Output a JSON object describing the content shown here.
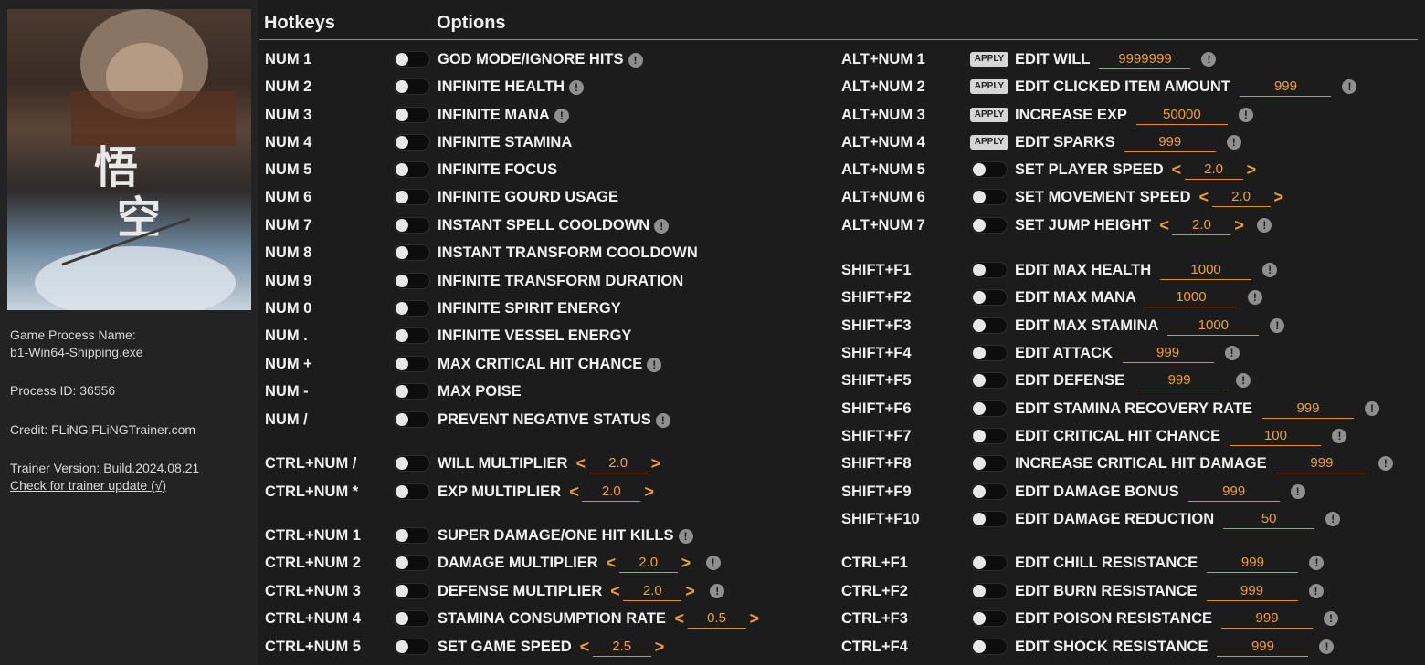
{
  "headers": {
    "hotkeys": "Hotkeys",
    "options": "Options"
  },
  "sidebar": {
    "process_name_label": "Game Process Name:",
    "process_name": "b1-Win64-Shipping.exe",
    "process_id": "Process ID: 36556",
    "credit": "Credit: FLiNG|FLiNGTrainer.com",
    "version": "Trainer Version: Build.2024.08.21",
    "update_link": "Check for trainer update (√)"
  },
  "apply_label": "APPLY",
  "left_options": [
    {
      "key": "NUM 1",
      "label": "GOD MODE/IGNORE HITS",
      "info": true
    },
    {
      "key": "NUM 2",
      "label": "INFINITE HEALTH",
      "info": true
    },
    {
      "key": "NUM 3",
      "label": "INFINITE MANA",
      "info": true
    },
    {
      "key": "NUM 4",
      "label": "INFINITE STAMINA",
      "info": false
    },
    {
      "key": "NUM 5",
      "label": "INFINITE FOCUS",
      "info": false
    },
    {
      "key": "NUM 6",
      "label": "INFINITE GOURD USAGE",
      "info": false
    },
    {
      "key": "NUM 7",
      "label": "INSTANT SPELL COOLDOWN",
      "info": true
    },
    {
      "key": "NUM 8",
      "label": "INSTANT TRANSFORM COOLDOWN",
      "info": false
    },
    {
      "key": "NUM 9",
      "label": "INFINITE TRANSFORM DURATION",
      "info": false
    },
    {
      "key": "NUM 0",
      "label": "INFINITE SPIRIT ENERGY",
      "info": false
    },
    {
      "key": "NUM .",
      "label": "INFINITE VESSEL ENERGY",
      "info": false
    },
    {
      "key": "NUM +",
      "label": "MAX CRITICAL HIT CHANCE",
      "info": true
    },
    {
      "key": "NUM -",
      "label": "MAX POISE",
      "info": false
    },
    {
      "key": "NUM /",
      "label": "PREVENT NEGATIVE STATUS",
      "info": true
    },
    {
      "key": "CTRL+NUM /",
      "label": "WILL MULTIPLIER",
      "info": false,
      "value": "2.0"
    },
    {
      "key": "CTRL+NUM *",
      "label": "EXP MULTIPLIER",
      "info": false,
      "value": "2.0"
    },
    {
      "key": "CTRL+NUM 1",
      "label": "SUPER DAMAGE/ONE HIT KILLS",
      "info": true
    },
    {
      "key": "CTRL+NUM 2",
      "label": "DAMAGE MULTIPLIER",
      "info": true,
      "value": "2.0"
    },
    {
      "key": "CTRL+NUM 3",
      "label": "DEFENSE MULTIPLIER",
      "info": true,
      "value": "2.0"
    },
    {
      "key": "CTRL+NUM 4",
      "label": "STAMINA CONSUMPTION RATE",
      "info": false,
      "value": "0.5"
    },
    {
      "key": "CTRL+NUM 5",
      "label": "SET GAME SPEED",
      "info": false,
      "value": "2.5"
    }
  ],
  "right_options": [
    {
      "key": "ALT+NUM 1",
      "label": "EDIT WILL",
      "control": "apply",
      "value": "9999999",
      "info": true
    },
    {
      "key": "ALT+NUM 2",
      "label": "EDIT CLICKED ITEM AMOUNT",
      "control": "apply",
      "value": "999",
      "info": true
    },
    {
      "key": "ALT+NUM 3",
      "label": "INCREASE EXP",
      "control": "apply",
      "value": "50000",
      "info": true
    },
    {
      "key": "ALT+NUM 4",
      "label": "EDIT SPARKS",
      "control": "apply",
      "value": "999",
      "info": true
    },
    {
      "key": "ALT+NUM 5",
      "label": "SET PLAYER SPEED",
      "control": "toggle",
      "value": "2.0",
      "stepper": true,
      "info": false
    },
    {
      "key": "ALT+NUM 6",
      "label": "SET MOVEMENT SPEED",
      "control": "toggle",
      "value": "2.0",
      "stepper": true,
      "info": false
    },
    {
      "key": "ALT+NUM 7",
      "label": "SET JUMP HEIGHT",
      "control": "toggle",
      "value": "2.0",
      "stepper": true,
      "info": true
    },
    {
      "key": "SHIFT+F1",
      "label": "EDIT MAX HEALTH",
      "control": "toggle",
      "value": "1000",
      "info": true
    },
    {
      "key": "SHIFT+F2",
      "label": "EDIT MAX MANA",
      "control": "toggle",
      "value": "1000",
      "info": true
    },
    {
      "key": "SHIFT+F3",
      "label": "EDIT MAX STAMINA",
      "control": "toggle",
      "value": "1000",
      "info": true
    },
    {
      "key": "SHIFT+F4",
      "label": "EDIT ATTACK",
      "control": "toggle",
      "value": "999",
      "info": true
    },
    {
      "key": "SHIFT+F5",
      "label": "EDIT DEFENSE",
      "control": "toggle",
      "value": "999",
      "info": true
    },
    {
      "key": "SHIFT+F6",
      "label": "EDIT STAMINA RECOVERY RATE",
      "control": "toggle",
      "value": "999",
      "info": true
    },
    {
      "key": "SHIFT+F7",
      "label": "EDIT CRITICAL HIT CHANCE",
      "control": "toggle",
      "value": "100",
      "info": true
    },
    {
      "key": "SHIFT+F8",
      "label": "INCREASE CRITICAL HIT DAMAGE",
      "control": "toggle",
      "value": "999",
      "info": true
    },
    {
      "key": "SHIFT+F9",
      "label": "EDIT DAMAGE BONUS",
      "control": "toggle",
      "value": "999",
      "info": true
    },
    {
      "key": "SHIFT+F10",
      "label": "EDIT DAMAGE REDUCTION",
      "control": "toggle",
      "value": "50",
      "info": true
    },
    {
      "key": "CTRL+F1",
      "label": "EDIT CHILL RESISTANCE",
      "control": "toggle",
      "value": "999",
      "info": true
    },
    {
      "key": "CTRL+F2",
      "label": "EDIT BURN RESISTANCE",
      "control": "toggle",
      "value": "999",
      "info": true
    },
    {
      "key": "CTRL+F3",
      "label": "EDIT POISON RESISTANCE",
      "control": "toggle",
      "value": "999",
      "info": true
    },
    {
      "key": "CTRL+F4",
      "label": "EDIT SHOCK RESISTANCE",
      "control": "toggle",
      "value": "999",
      "info": true
    }
  ]
}
